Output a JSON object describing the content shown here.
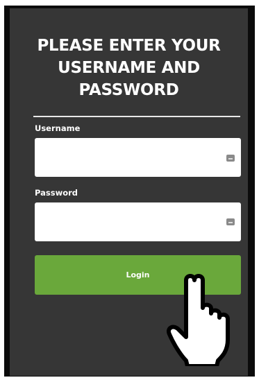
{
  "heading": "PLEASE ENTER YOUR USERNAME AND PASSWORD",
  "username": {
    "label": "Username",
    "value": "",
    "icon": "password-manager-icon"
  },
  "password": {
    "label": "Password",
    "value": "",
    "icon": "password-manager-icon"
  },
  "login_button": {
    "label": "Login",
    "color": "#6aa83b"
  },
  "cursor": "hand-pointer-icon",
  "colors": {
    "panel": "#363636",
    "frame": "#0b0b0b",
    "text": "#ffffff"
  }
}
